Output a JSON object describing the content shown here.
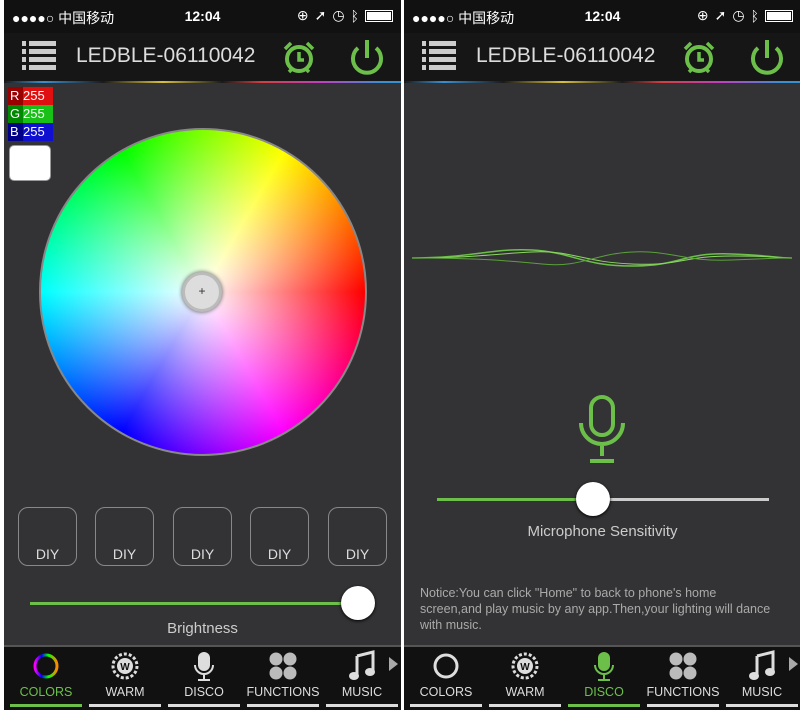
{
  "status": {
    "carrier": "●●●●○ 中国移动",
    "time": "12:04"
  },
  "header": {
    "title": "LEDBLE-06110042"
  },
  "colors_screen": {
    "r_label": "R",
    "r": "255",
    "g_label": "G",
    "g": "255",
    "b_label": "B",
    "b": "255",
    "diy": [
      "DIY",
      "DIY",
      "DIY",
      "DIY",
      "DIY"
    ],
    "brightness_label": "Brightness",
    "brightness": 1.0
  },
  "disco_screen": {
    "mic_label": "Microphone Sensitivity",
    "sensitivity": 0.47,
    "notice": "Notice:You can click \"Home\" to back to phone's home screen,and play music by any app.Then,your lighting will dance with music."
  },
  "tabs": [
    {
      "label": "COLORS",
      "icon": "color-ring-icon"
    },
    {
      "label": "WARM",
      "icon": "warm-sun-icon"
    },
    {
      "label": "DISCO",
      "icon": "microphone-icon"
    },
    {
      "label": "FUNCTIONS",
      "icon": "functions-icon"
    },
    {
      "label": "MUSIC",
      "icon": "music-note-icon"
    }
  ],
  "colors": {
    "accent": "#6cc04a",
    "background": "#333335",
    "bar": "#111111"
  }
}
